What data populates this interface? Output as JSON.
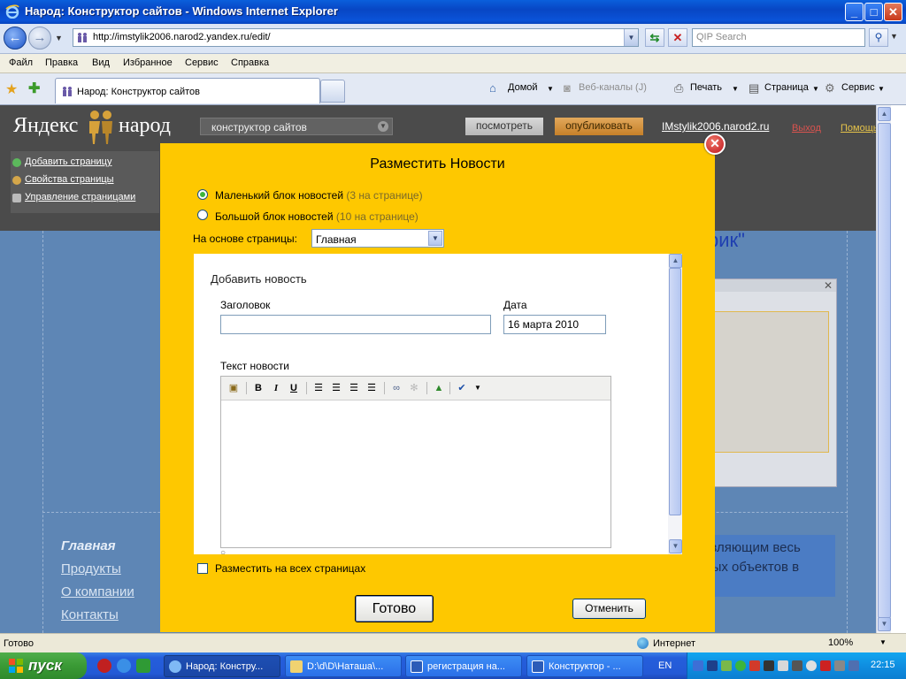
{
  "window": {
    "title": "Народ: Конструктор сайтов - Windows Internet Explorer",
    "min": "_",
    "max": "□",
    "close": "✕"
  },
  "address": {
    "url": "http://imstylik2006.narod2.yandex.ru/edit/",
    "search_placeholder": "QIP Search"
  },
  "menu": [
    "Файл",
    "Правка",
    "Вид",
    "Избранное",
    "Сервис",
    "Справка"
  ],
  "tab": {
    "title": "Народ: Конструктор сайтов"
  },
  "ie_toolbar": {
    "home": "Домой",
    "feeds": "Веб-каналы (J)",
    "print": "Печать",
    "page": "Страница",
    "tools": "Сервис"
  },
  "site_header": {
    "logo_left": "Яндекс",
    "logo_right": "народ",
    "constructor_select": "конструктор сайтов",
    "view_button": "посмотреть",
    "publish_button": "опубликовать",
    "site_link": "IMstylik2006.narod2.ru",
    "logout": "Выход",
    "help": "Помощь",
    "side_links": [
      "Добавить страницу",
      "Свойства страницы",
      "Управление страницами"
    ]
  },
  "page_bg": {
    "title_fragment": "рик\"",
    "footer_links": [
      "Главная",
      "Продукты",
      "О компании",
      "Контакты"
    ],
    "blue_text": [
      "ствляющим весь",
      "нных объектов в"
    ]
  },
  "dialog": {
    "title": "Разместить Новости",
    "option_small": "Маленький блок новостей",
    "option_small_hint": "(3 на странице)",
    "option_large": "Большой блок новостей",
    "option_large_hint": "(10 на странице)",
    "basis_label": "На основе страницы:",
    "basis_value": "Главная",
    "add_news_title": "Добавить новость",
    "header_label": "Заголовок",
    "date_label": "Дата",
    "date_value": "16 марта 2010",
    "text_label": "Текст новости",
    "all_pages_label": "Разместить на всех страницах",
    "done_button": "Готово",
    "cancel_button": "Отменить",
    "editor_tools": [
      "paste-word-icon",
      "bold-icon",
      "italic-icon",
      "underline-icon",
      "align-left-icon",
      "align-center-icon",
      "align-right-icon",
      "align-justify-icon",
      "link-icon",
      "unlink-icon",
      "image-icon",
      "spellcheck-icon"
    ],
    "editor_labels": {
      "bold": "B",
      "italic": "I",
      "underline": "U"
    }
  },
  "status": {
    "text": "Готово",
    "zone": "Интернет",
    "zoom": "100%"
  },
  "taskbar": {
    "start": "пуск",
    "tasks": [
      "Народ: Констру...",
      "D:\\d\\D\\Наташа\\...",
      "регистрация на...",
      "Конструктор - ..."
    ],
    "lang": "EN",
    "clock": "22:15"
  }
}
